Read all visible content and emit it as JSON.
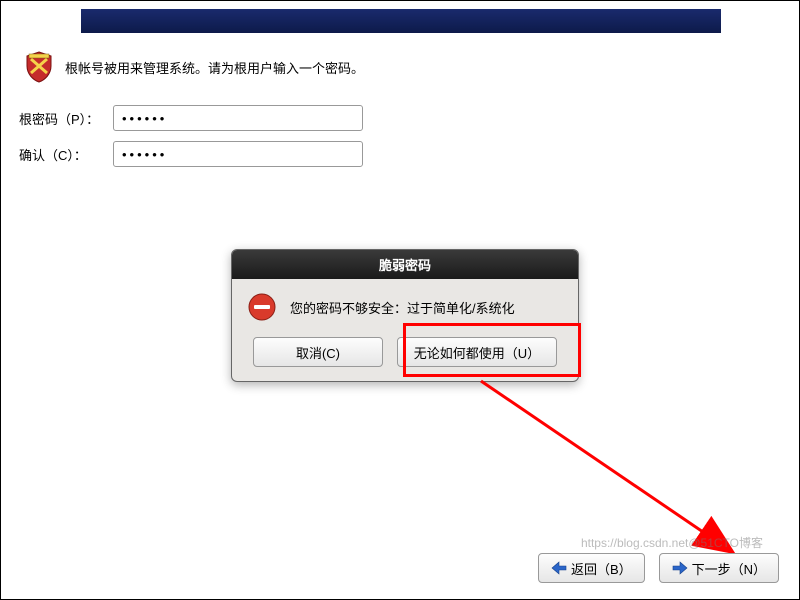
{
  "intro": {
    "text": "根帐号被用来管理系统。请为根用户输入一个密码。"
  },
  "form": {
    "password_label": "根密码（P）：",
    "confirm_label": "确认（C）：",
    "password_value": "••••••",
    "confirm_value": "••••••"
  },
  "dialog": {
    "title": "脆弱密码",
    "message": "您的密码不够安全：过于简单化/系统化",
    "cancel_label": "取消(C)",
    "use_label": "无论如何都使用（U）"
  },
  "footer": {
    "back_label": "返回（B）",
    "next_label": "下一步（N）"
  },
  "watermark": "https://blog.csdn.net@51CTO博客"
}
